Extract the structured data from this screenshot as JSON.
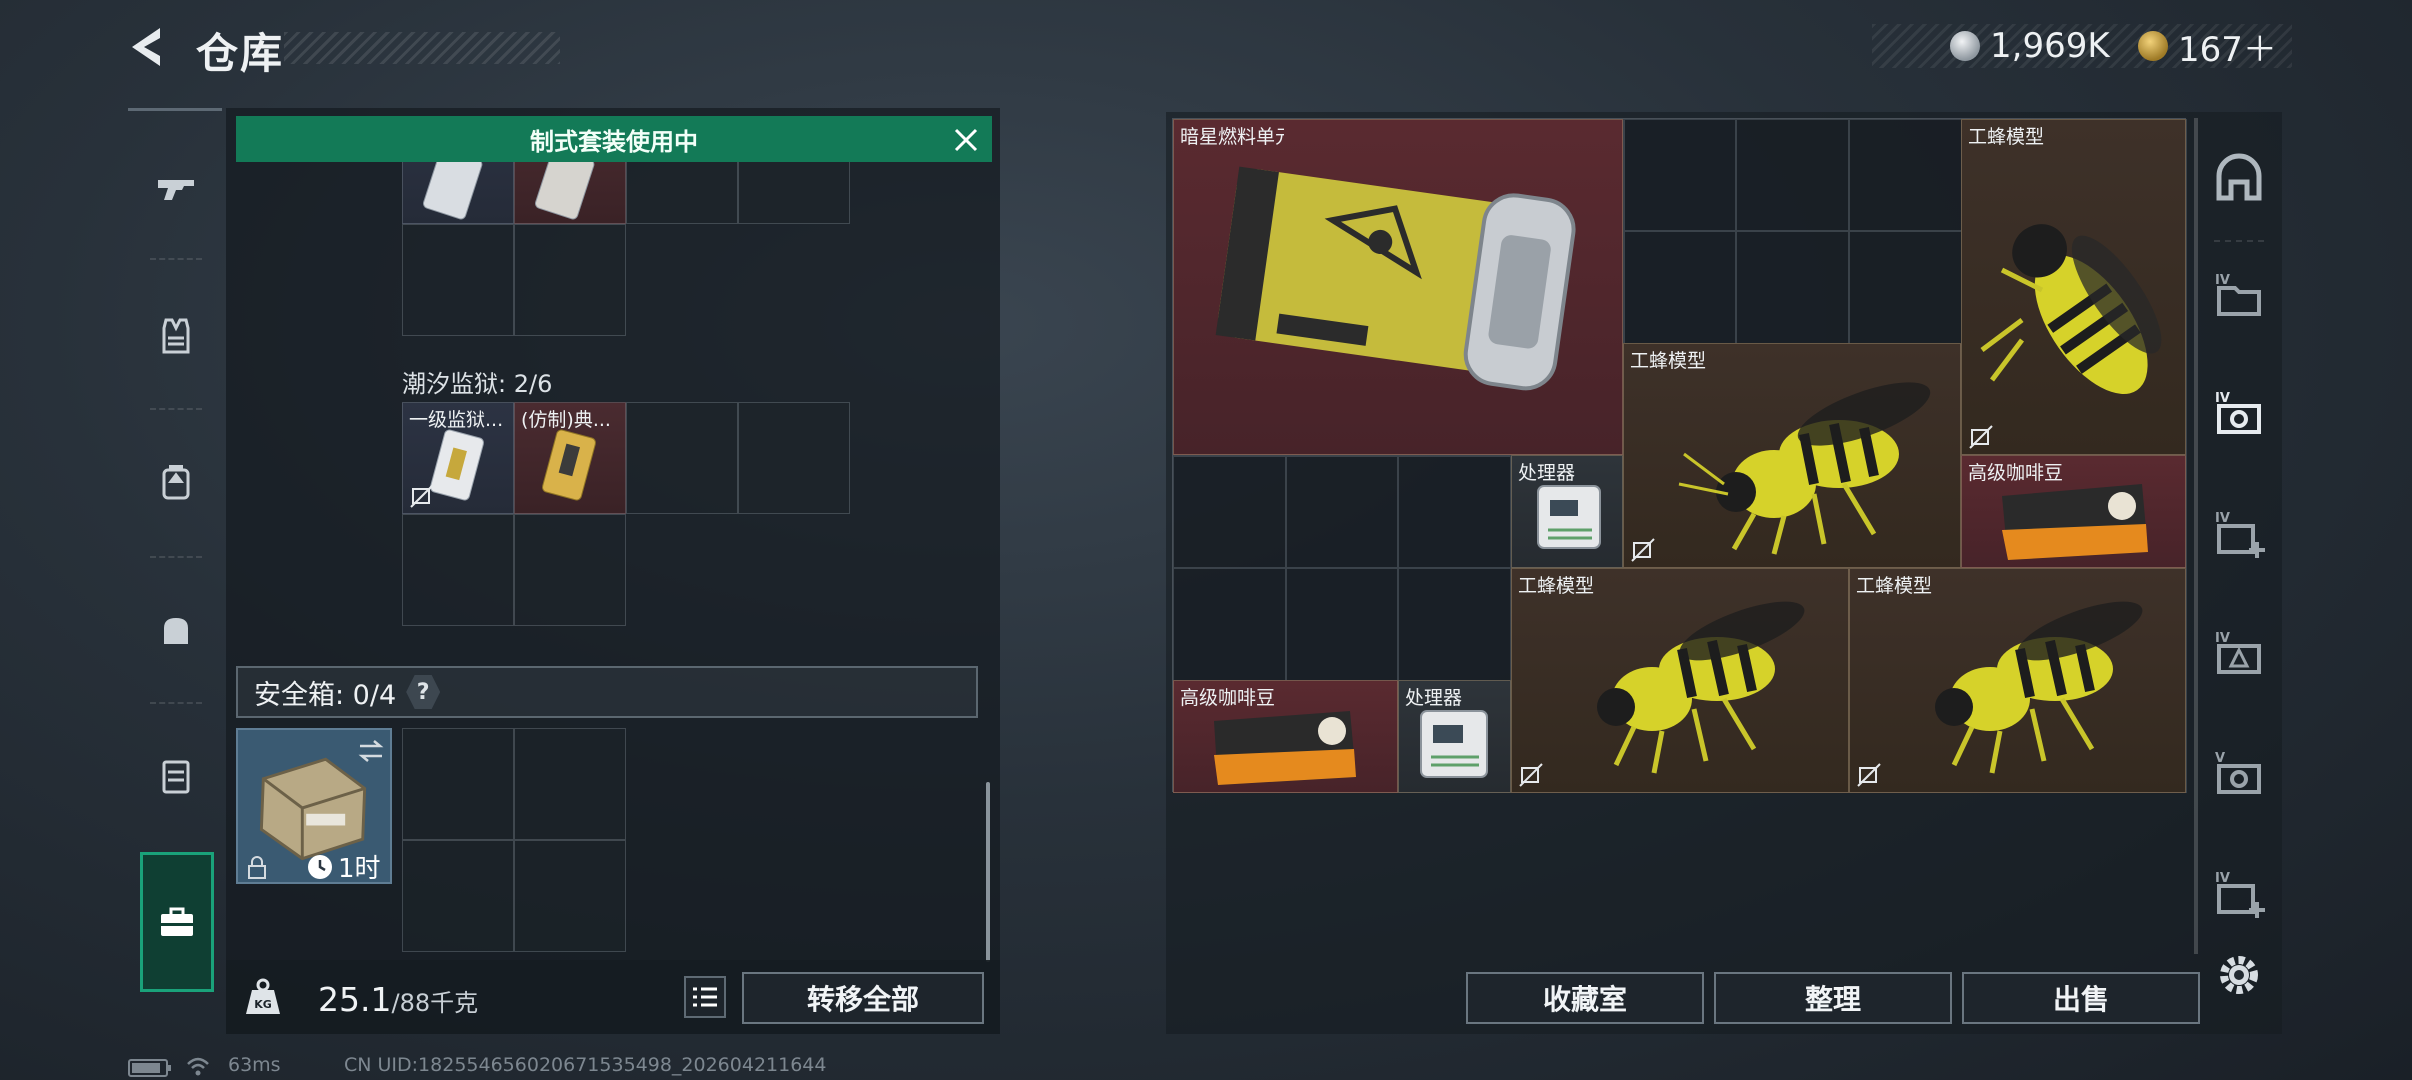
{
  "header": {
    "title": "仓库",
    "currency_silver": "1,969K",
    "currency_gold": "167＋"
  },
  "left_nav": {
    "items": [
      "gun-icon",
      "vest-icon",
      "backpack-icon",
      "pouch-icon",
      "case-icon",
      "toolbox-icon"
    ],
    "active": "toolbox-icon"
  },
  "loadout": {
    "banner": "制式套装使用中",
    "tidal_prison_title": "潮汐监狱: 2/6",
    "tidal_items": [
      "一级监狱...",
      "(仿制)典..."
    ],
    "safebox_title": "安全箱: 0/4",
    "help_label": "?",
    "safebox_timer": "1时"
  },
  "bottom_left": {
    "weight_current": "25.1",
    "weight_max": "/88千克",
    "transfer_all": "转移全部"
  },
  "stash": {
    "items": {
      "fuel": "暗星燃料单元",
      "worker_bee_1": "工蜂模型",
      "worker_bee_2": "工蜂模型",
      "processor_1": "处理器",
      "coffee_1": "高级咖啡豆",
      "worker_bee_3": "工蜂模型",
      "worker_bee_4": "工蜂模型",
      "coffee_2": "高级咖啡豆",
      "processor_2": "处理器"
    }
  },
  "bottom_right": {
    "collection": "收藏室",
    "sort": "整理",
    "sell": "出售"
  },
  "right_tabs": [
    "helmet-icon",
    "folder-iv-icon",
    "camera-iv-icon",
    "add-iv-icon",
    "alert-iv-icon",
    "camera-iv-icon-2",
    "add-iv-icon-2"
  ],
  "status": {
    "ping": "63ms",
    "uid": "CN UID:1825546560206715354​98_202604211644"
  }
}
